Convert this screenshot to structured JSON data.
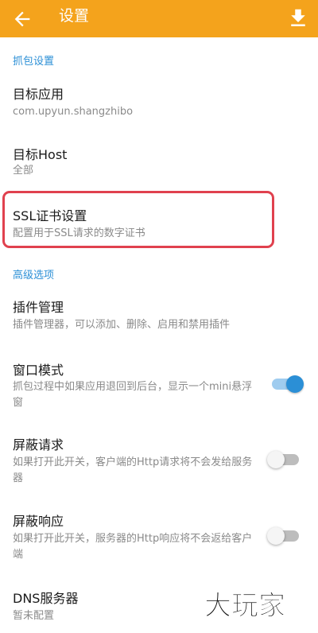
{
  "appbar": {
    "title": "设置",
    "back_icon": "arrow-left-icon",
    "download_icon": "download-icon",
    "color": "#f4a31c"
  },
  "sections": {
    "capture": "抓包设置",
    "advanced": "高级选项"
  },
  "items": {
    "target_app": {
      "title": "目标应用",
      "summary": "com.upyun.shangzhibo"
    },
    "target_host": {
      "title": "目标Host",
      "summary": "全部"
    },
    "ssl": {
      "title": "SSL证书设置",
      "summary": "配置用于SSL请求的数字证书"
    },
    "plugins": {
      "title": "插件管理",
      "summary": "插件管理器，可以添加、删除、启用和禁用插件"
    },
    "window_mode": {
      "title": "窗口模式",
      "summary": "抓包过程中如果应用退回到后台，显示一个mini悬浮窗",
      "enabled": true
    },
    "block_request": {
      "title": "屏蔽请求",
      "summary": "如果打开此开关，客户端的Http请求将不会发给服务器",
      "enabled": false
    },
    "block_response": {
      "title": "屏蔽响应",
      "summary": "如果打开此开关，服务器的Http响应将不会返给客户端",
      "enabled": false
    },
    "dns": {
      "title": "DNS服务器",
      "summary": "暂未配置"
    }
  },
  "watermark": "大玩家",
  "colors": {
    "accent": "#2b8fd6",
    "highlight": "#e0414e"
  }
}
